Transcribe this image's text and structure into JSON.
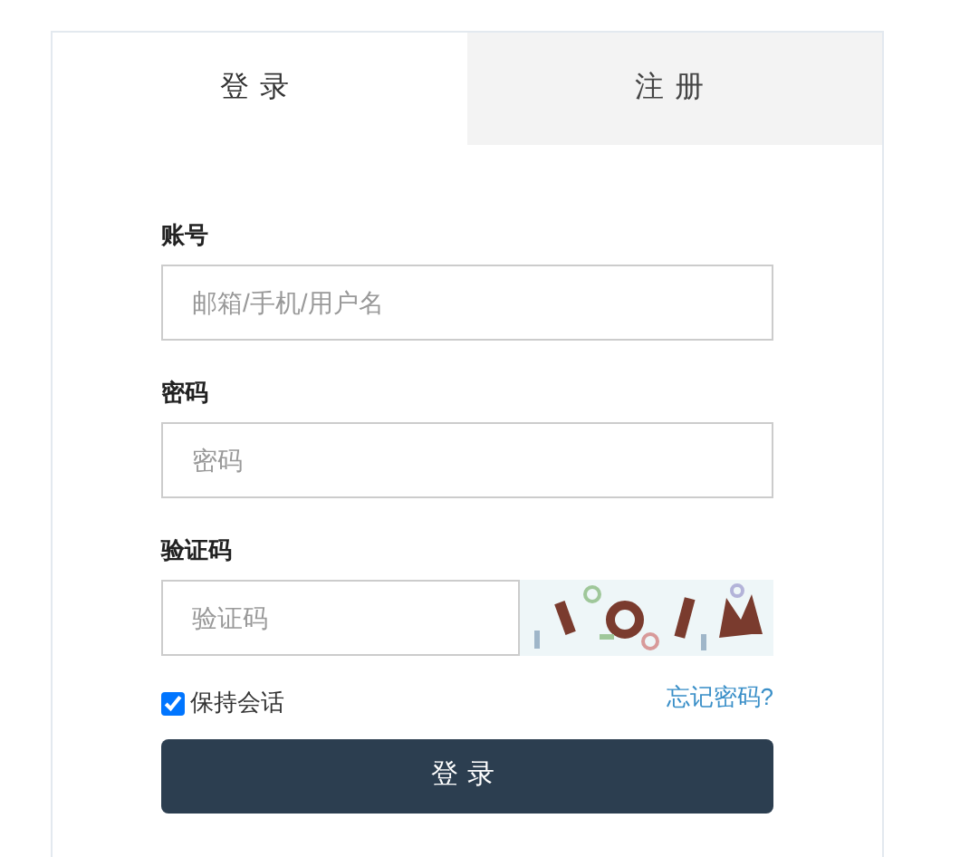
{
  "tabs": [
    {
      "label": "登录",
      "selected": true
    },
    {
      "label": "注册",
      "selected": false
    }
  ],
  "fields": [
    {
      "label": "账号",
      "placeholder": "邮箱/手机/用户名",
      "kind": "text"
    },
    {
      "label": "密码",
      "placeholder": "密码",
      "kind": "password"
    },
    {
      "label": "验证码",
      "placeholder": "验证码",
      "kind": "captcha"
    }
  ],
  "keep_session": {
    "label": "保持会话",
    "checked": true
  },
  "forgot_link": "忘记密码?",
  "submit_button": "登录"
}
